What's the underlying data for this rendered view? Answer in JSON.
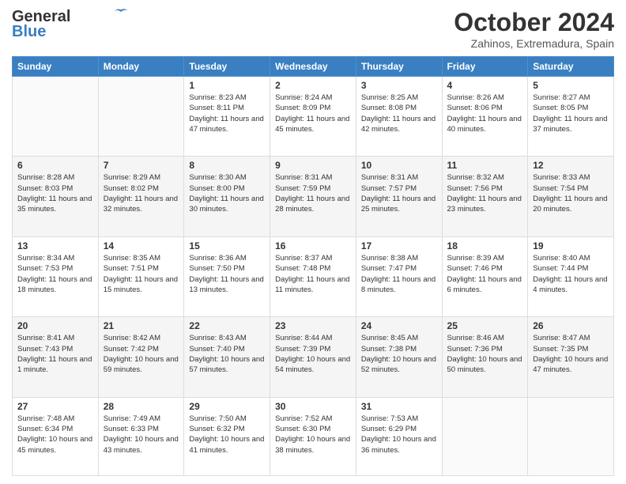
{
  "header": {
    "logo_line1": "General",
    "logo_line2": "Blue",
    "title": "October 2024",
    "subtitle": "Zahinos, Extremadura, Spain"
  },
  "columns": [
    "Sunday",
    "Monday",
    "Tuesday",
    "Wednesday",
    "Thursday",
    "Friday",
    "Saturday"
  ],
  "weeks": [
    [
      {
        "day": "",
        "info": ""
      },
      {
        "day": "",
        "info": ""
      },
      {
        "day": "1",
        "info": "Sunrise: 8:23 AM\nSunset: 8:11 PM\nDaylight: 11 hours and 47 minutes."
      },
      {
        "day": "2",
        "info": "Sunrise: 8:24 AM\nSunset: 8:09 PM\nDaylight: 11 hours and 45 minutes."
      },
      {
        "day": "3",
        "info": "Sunrise: 8:25 AM\nSunset: 8:08 PM\nDaylight: 11 hours and 42 minutes."
      },
      {
        "day": "4",
        "info": "Sunrise: 8:26 AM\nSunset: 8:06 PM\nDaylight: 11 hours and 40 minutes."
      },
      {
        "day": "5",
        "info": "Sunrise: 8:27 AM\nSunset: 8:05 PM\nDaylight: 11 hours and 37 minutes."
      }
    ],
    [
      {
        "day": "6",
        "info": "Sunrise: 8:28 AM\nSunset: 8:03 PM\nDaylight: 11 hours and 35 minutes."
      },
      {
        "day": "7",
        "info": "Sunrise: 8:29 AM\nSunset: 8:02 PM\nDaylight: 11 hours and 32 minutes."
      },
      {
        "day": "8",
        "info": "Sunrise: 8:30 AM\nSunset: 8:00 PM\nDaylight: 11 hours and 30 minutes."
      },
      {
        "day": "9",
        "info": "Sunrise: 8:31 AM\nSunset: 7:59 PM\nDaylight: 11 hours and 28 minutes."
      },
      {
        "day": "10",
        "info": "Sunrise: 8:31 AM\nSunset: 7:57 PM\nDaylight: 11 hours and 25 minutes."
      },
      {
        "day": "11",
        "info": "Sunrise: 8:32 AM\nSunset: 7:56 PM\nDaylight: 11 hours and 23 minutes."
      },
      {
        "day": "12",
        "info": "Sunrise: 8:33 AM\nSunset: 7:54 PM\nDaylight: 11 hours and 20 minutes."
      }
    ],
    [
      {
        "day": "13",
        "info": "Sunrise: 8:34 AM\nSunset: 7:53 PM\nDaylight: 11 hours and 18 minutes."
      },
      {
        "day": "14",
        "info": "Sunrise: 8:35 AM\nSunset: 7:51 PM\nDaylight: 11 hours and 15 minutes."
      },
      {
        "day": "15",
        "info": "Sunrise: 8:36 AM\nSunset: 7:50 PM\nDaylight: 11 hours and 13 minutes."
      },
      {
        "day": "16",
        "info": "Sunrise: 8:37 AM\nSunset: 7:48 PM\nDaylight: 11 hours and 11 minutes."
      },
      {
        "day": "17",
        "info": "Sunrise: 8:38 AM\nSunset: 7:47 PM\nDaylight: 11 hours and 8 minutes."
      },
      {
        "day": "18",
        "info": "Sunrise: 8:39 AM\nSunset: 7:46 PM\nDaylight: 11 hours and 6 minutes."
      },
      {
        "day": "19",
        "info": "Sunrise: 8:40 AM\nSunset: 7:44 PM\nDaylight: 11 hours and 4 minutes."
      }
    ],
    [
      {
        "day": "20",
        "info": "Sunrise: 8:41 AM\nSunset: 7:43 PM\nDaylight: 11 hours and 1 minute."
      },
      {
        "day": "21",
        "info": "Sunrise: 8:42 AM\nSunset: 7:42 PM\nDaylight: 10 hours and 59 minutes."
      },
      {
        "day": "22",
        "info": "Sunrise: 8:43 AM\nSunset: 7:40 PM\nDaylight: 10 hours and 57 minutes."
      },
      {
        "day": "23",
        "info": "Sunrise: 8:44 AM\nSunset: 7:39 PM\nDaylight: 10 hours and 54 minutes."
      },
      {
        "day": "24",
        "info": "Sunrise: 8:45 AM\nSunset: 7:38 PM\nDaylight: 10 hours and 52 minutes."
      },
      {
        "day": "25",
        "info": "Sunrise: 8:46 AM\nSunset: 7:36 PM\nDaylight: 10 hours and 50 minutes."
      },
      {
        "day": "26",
        "info": "Sunrise: 8:47 AM\nSunset: 7:35 PM\nDaylight: 10 hours and 47 minutes."
      }
    ],
    [
      {
        "day": "27",
        "info": "Sunrise: 7:48 AM\nSunset: 6:34 PM\nDaylight: 10 hours and 45 minutes."
      },
      {
        "day": "28",
        "info": "Sunrise: 7:49 AM\nSunset: 6:33 PM\nDaylight: 10 hours and 43 minutes."
      },
      {
        "day": "29",
        "info": "Sunrise: 7:50 AM\nSunset: 6:32 PM\nDaylight: 10 hours and 41 minutes."
      },
      {
        "day": "30",
        "info": "Sunrise: 7:52 AM\nSunset: 6:30 PM\nDaylight: 10 hours and 38 minutes."
      },
      {
        "day": "31",
        "info": "Sunrise: 7:53 AM\nSunset: 6:29 PM\nDaylight: 10 hours and 36 minutes."
      },
      {
        "day": "",
        "info": ""
      },
      {
        "day": "",
        "info": ""
      }
    ]
  ]
}
